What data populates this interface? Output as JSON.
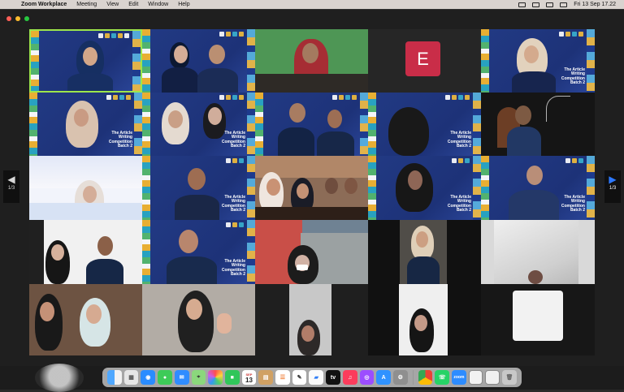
{
  "menu": {
    "apple_icon": "",
    "app_name": "Zoom Workplace",
    "items": [
      "Meeting",
      "View",
      "Edit",
      "Window",
      "Help"
    ],
    "date_time": "Fri 13 Sep  17.22"
  },
  "nav": {
    "left_page": "1/3",
    "right_page": "1/3"
  },
  "tiles": [
    {
      "id": "t1",
      "active": true,
      "variant": "brand-duo"
    },
    {
      "id": "t2",
      "active": false,
      "variant": "brand-duo"
    },
    {
      "id": "t3",
      "active": false,
      "variant": "green-solo"
    },
    {
      "id": "t4",
      "active": false,
      "variant": "avatar",
      "avatar_letter": "E"
    },
    {
      "id": "t5",
      "active": false,
      "variant": "brand-solo"
    },
    {
      "id": "t6",
      "active": false,
      "variant": "brand-solo"
    },
    {
      "id": "t7",
      "active": false,
      "variant": "brand-duo"
    },
    {
      "id": "t8",
      "active": false,
      "variant": "brand-duo"
    },
    {
      "id": "t9",
      "active": false,
      "variant": "brand-dark"
    },
    {
      "id": "t10",
      "active": false,
      "variant": "dark-solo"
    }
  ],
  "competition_text": "The Article\nWriting\nCompetition\nBatch 2",
  "dock": {
    "items": [
      "finder-icon",
      "launchpad-icon",
      "safari-icon",
      "messages-icon",
      "mail-icon",
      "maps-icon",
      "photos-icon",
      "facetime-icon",
      "calendar-icon",
      "notes-icon",
      "reminders-icon",
      "freeform-icon",
      "appletv-icon",
      "music-icon",
      "podcasts-icon",
      "appstore-icon",
      "settings-icon",
      "chrome-icon",
      "whatsapp-icon",
      "zoom-icon",
      "preview-icon",
      "trash-icon"
    ],
    "calendar_month": "SEP",
    "calendar_day": "13",
    "zoom_label": "zoom"
  }
}
